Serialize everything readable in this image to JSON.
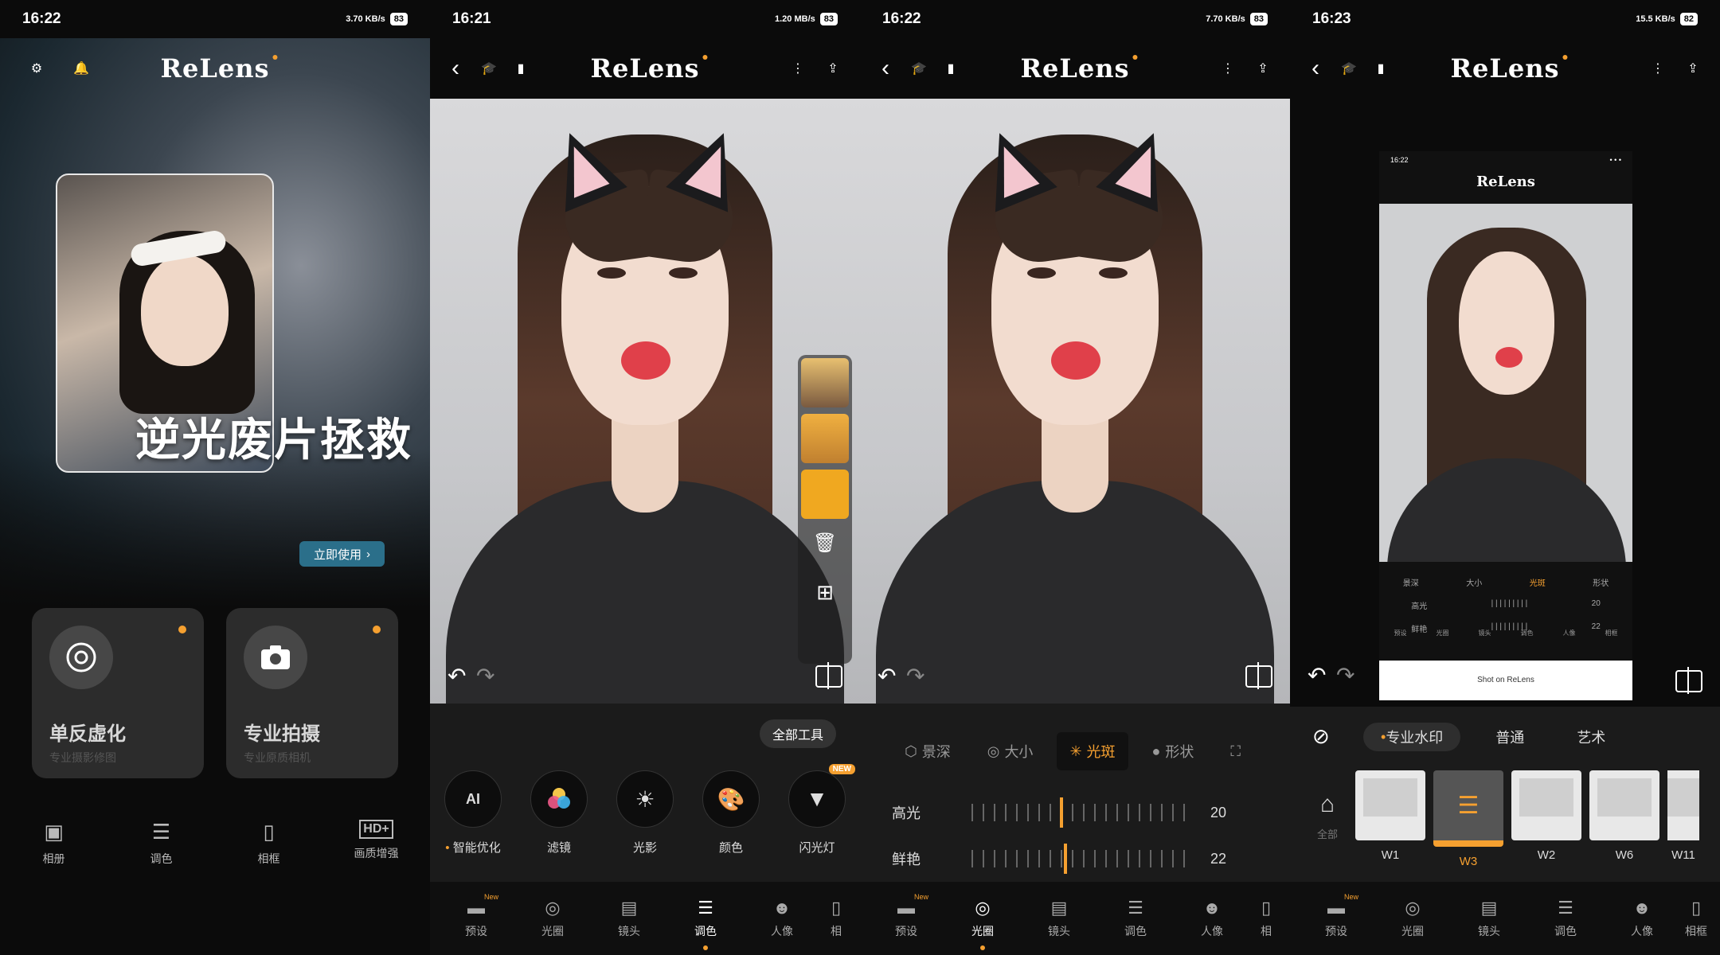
{
  "screen1": {
    "status": {
      "time": "16:22",
      "speed": "3.70 KB/s",
      "battery": "83"
    },
    "logo": "ReLens",
    "hero_title": "逆光废片拯救",
    "use_button": "立即使用",
    "features": [
      {
        "title": "单反虚化",
        "sub": "专业摄影修图"
      },
      {
        "title": "专业拍摄",
        "sub": "专业原质相机"
      }
    ],
    "nav": [
      {
        "label": "相册"
      },
      {
        "label": "调色"
      },
      {
        "label": "相框"
      },
      {
        "label": "画质增强"
      }
    ]
  },
  "screen2": {
    "status": {
      "time": "16:21",
      "speed": "1.20 MB/s",
      "battery": "83"
    },
    "logo": "ReLens",
    "all_tools": "全部工具",
    "tools": [
      {
        "label": "智能优化",
        "icon": "ai-icon"
      },
      {
        "label": "滤镜",
        "icon": "filter-icon"
      },
      {
        "label": "光影",
        "icon": "light-icon"
      },
      {
        "label": "颜色",
        "icon": "palette-icon"
      },
      {
        "label": "闪光灯",
        "icon": "flash-icon",
        "badge": "NEW"
      }
    ],
    "bottom_nav": [
      {
        "label": "预设",
        "badge": "New"
      },
      {
        "label": "光圈"
      },
      {
        "label": "镜头"
      },
      {
        "label": "调色"
      },
      {
        "label": "人像"
      },
      {
        "label": "相"
      }
    ]
  },
  "screen3": {
    "status": {
      "time": "16:22",
      "speed": "7.70 KB/s",
      "battery": "83"
    },
    "logo": "ReLens",
    "segments": [
      {
        "label": "景深"
      },
      {
        "label": "大小"
      },
      {
        "label": "光斑"
      },
      {
        "label": "形状"
      }
    ],
    "sliders": [
      {
        "label": "高光",
        "value": "20",
        "level": 0.41
      },
      {
        "label": "鲜艳",
        "value": "22",
        "level": 0.43
      }
    ],
    "bottom_nav": [
      {
        "label": "预设",
        "badge": "New"
      },
      {
        "label": "光圈"
      },
      {
        "label": "镜头"
      },
      {
        "label": "调色"
      },
      {
        "label": "人像"
      },
      {
        "label": "相"
      }
    ]
  },
  "screen4": {
    "status": {
      "time": "16:23",
      "speed": "15.5 KB/s",
      "battery": "82"
    },
    "logo": "ReLens",
    "mini": {
      "time": "16:22",
      "logo": "ReLens",
      "segments": [
        "景深",
        "大小",
        "光斑",
        "形状"
      ],
      "s1": "高光",
      "v1": "20",
      "s2": "鲜艳",
      "v2": "22",
      "nav": [
        "预设",
        "光圈",
        "镜头",
        "调色",
        "人像",
        "相框"
      ],
      "shot": "Shot on ReLens"
    },
    "tabs": [
      {
        "label": "专业水印"
      },
      {
        "label": "普通"
      },
      {
        "label": "艺术"
      }
    ],
    "store_label": "全部",
    "watermarks": [
      {
        "label": "W1"
      },
      {
        "label": "W3"
      },
      {
        "label": "W2"
      },
      {
        "label": "W6"
      },
      {
        "label": "W11"
      }
    ],
    "bottom_nav": [
      {
        "label": "预设",
        "badge": "New"
      },
      {
        "label": "光圈"
      },
      {
        "label": "镜头"
      },
      {
        "label": "调色"
      },
      {
        "label": "人像"
      },
      {
        "label": "相框"
      }
    ]
  },
  "colors": {
    "accent": "#f5a030",
    "panel": "#1b1b1b",
    "button": "#2b6f8a"
  }
}
